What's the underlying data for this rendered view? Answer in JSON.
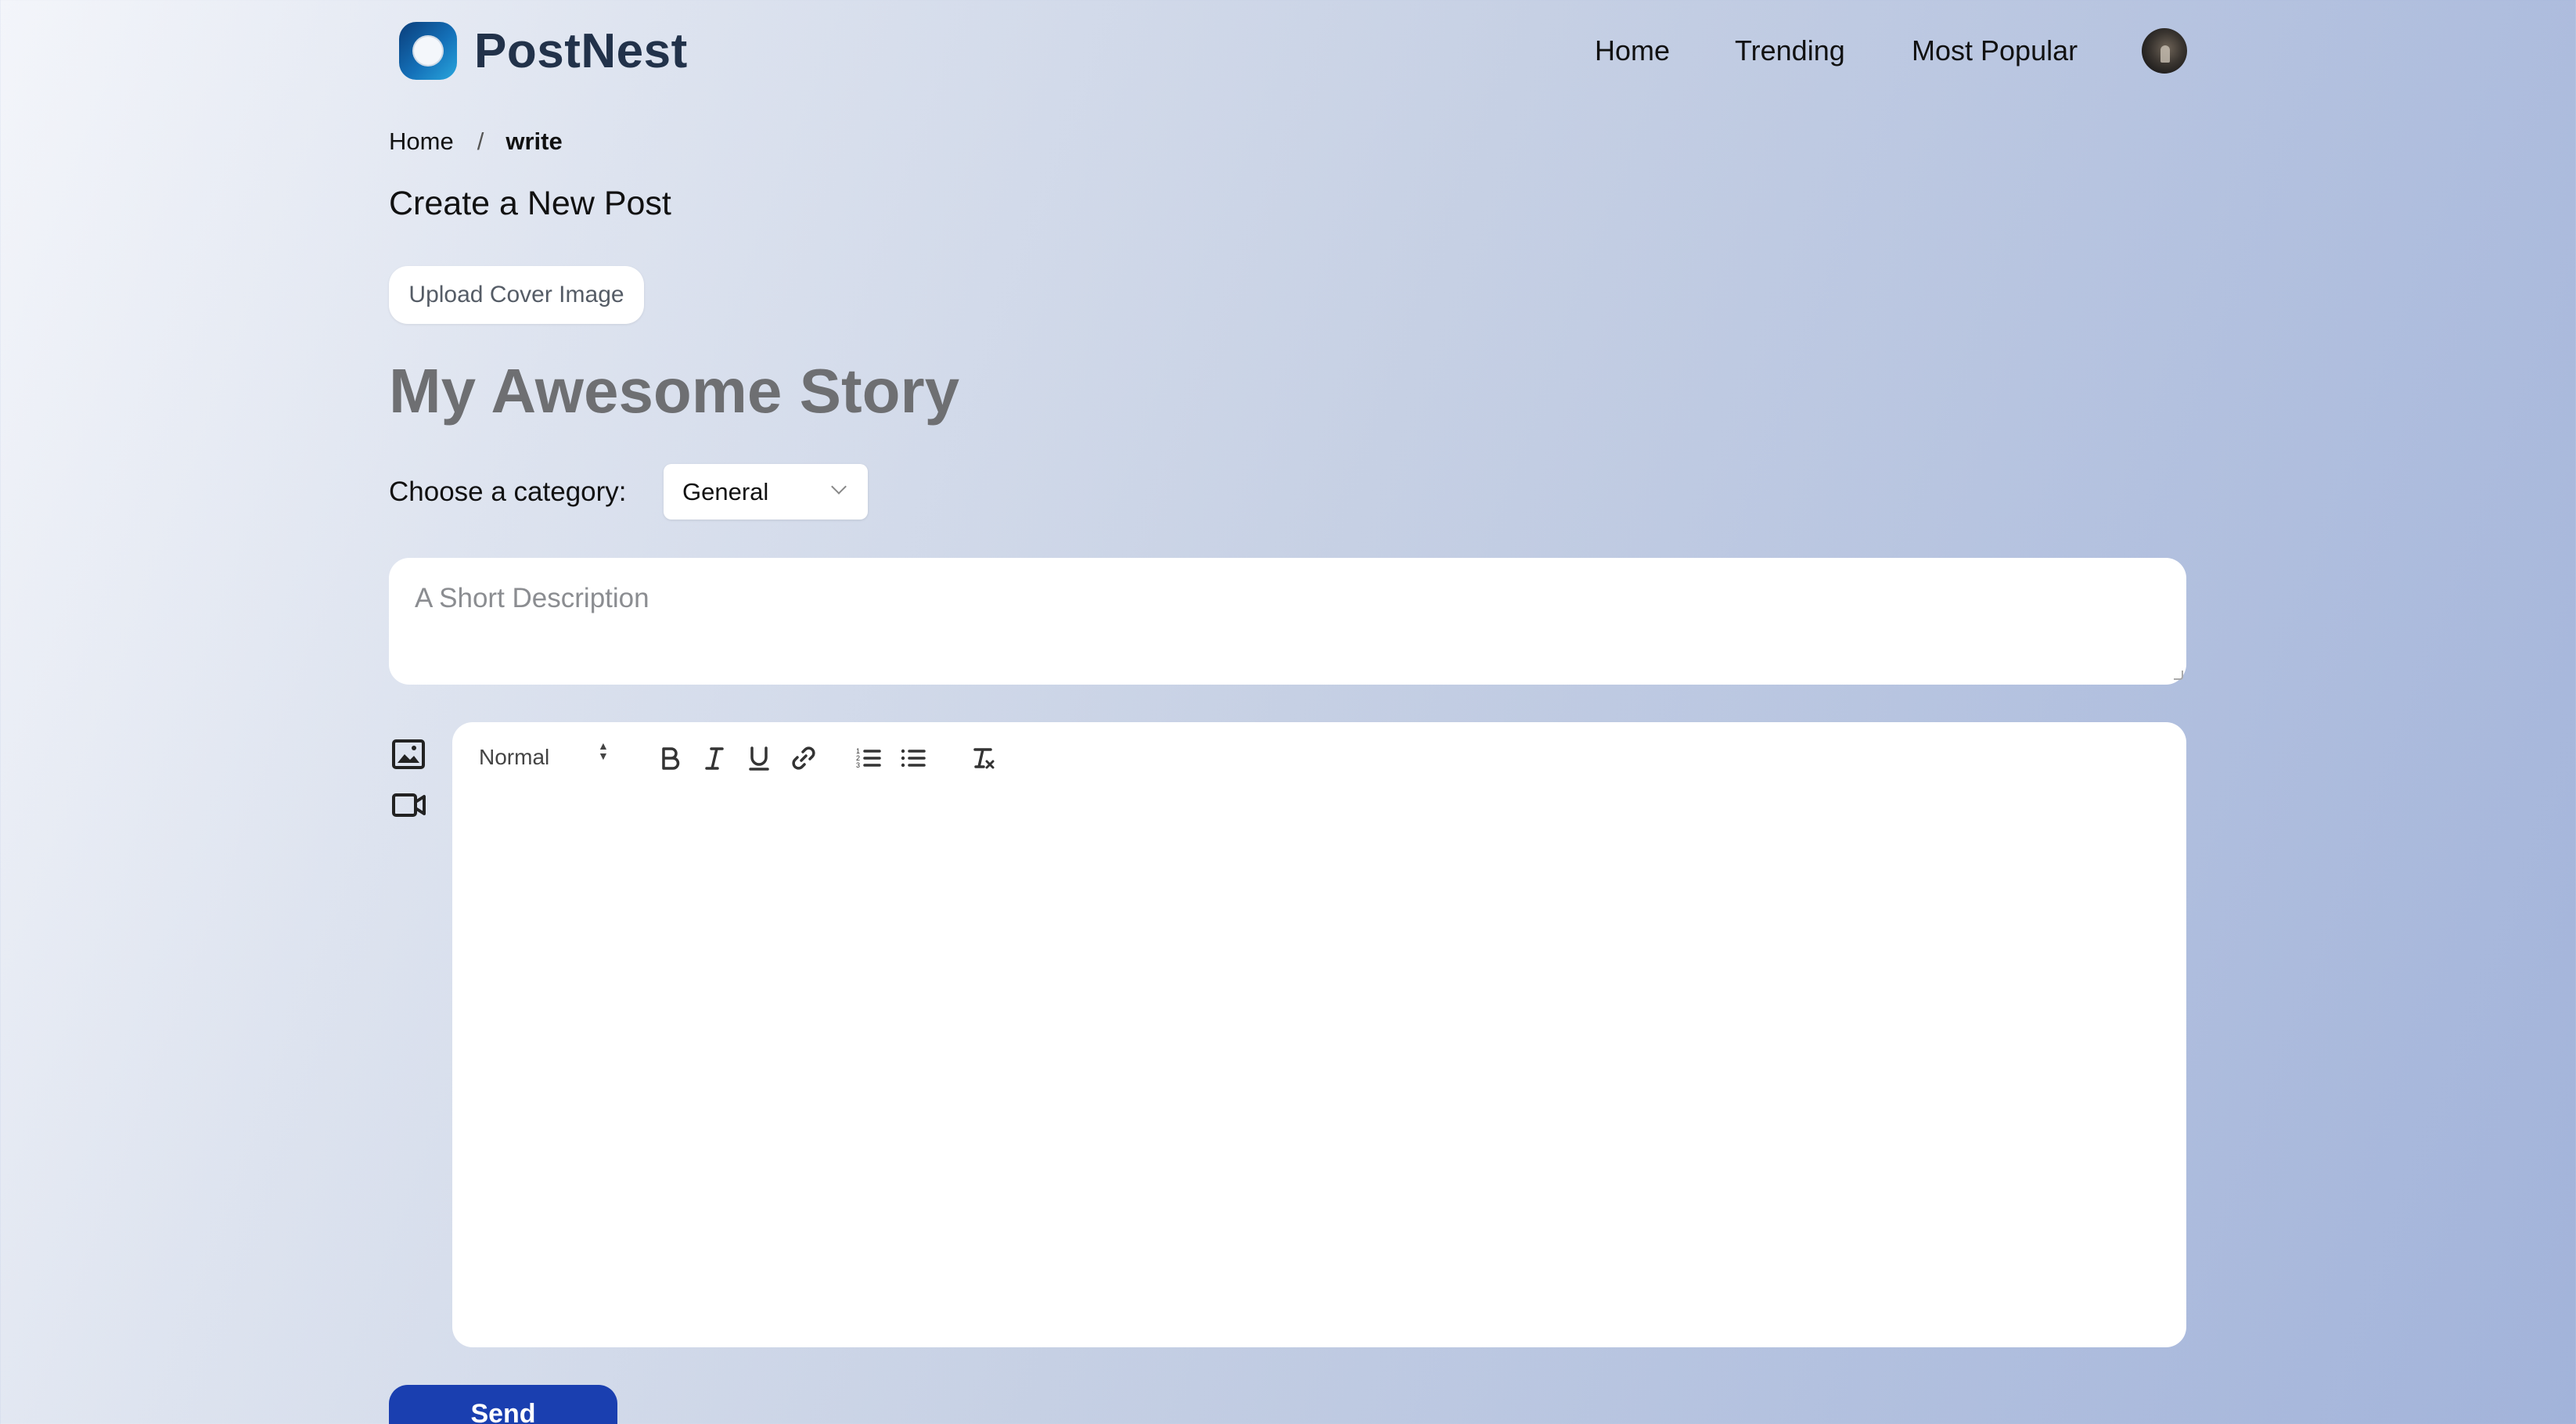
{
  "brand": {
    "name": "PostNest"
  },
  "nav": {
    "items": [
      {
        "label": "Home"
      },
      {
        "label": "Trending"
      },
      {
        "label": "Most Popular"
      }
    ]
  },
  "breadcrumb": {
    "items": [
      "Home",
      "write"
    ],
    "separator": "/"
  },
  "page": {
    "title": "Create a New Post"
  },
  "form": {
    "upload_label": "Upload Cover Image",
    "title_value": "My Awesome Story",
    "category_label": "Choose a category:",
    "category_selected": "General",
    "description_placeholder": "A Short Description",
    "description_value": ""
  },
  "editor": {
    "format_selected": "Normal",
    "toolbar_icons": [
      "bold-icon",
      "italic-icon",
      "underline-icon",
      "link-icon",
      "ordered-list-icon",
      "bullet-list-icon",
      "clear-format-icon"
    ],
    "side_icons": [
      "image-icon",
      "video-icon"
    ]
  },
  "send_label": "Send",
  "colors": {
    "primary_button": "#1a3fb0",
    "brand_text": "#22324a",
    "background_start": "#f3f5fa",
    "background_end": "#a2b3da"
  }
}
